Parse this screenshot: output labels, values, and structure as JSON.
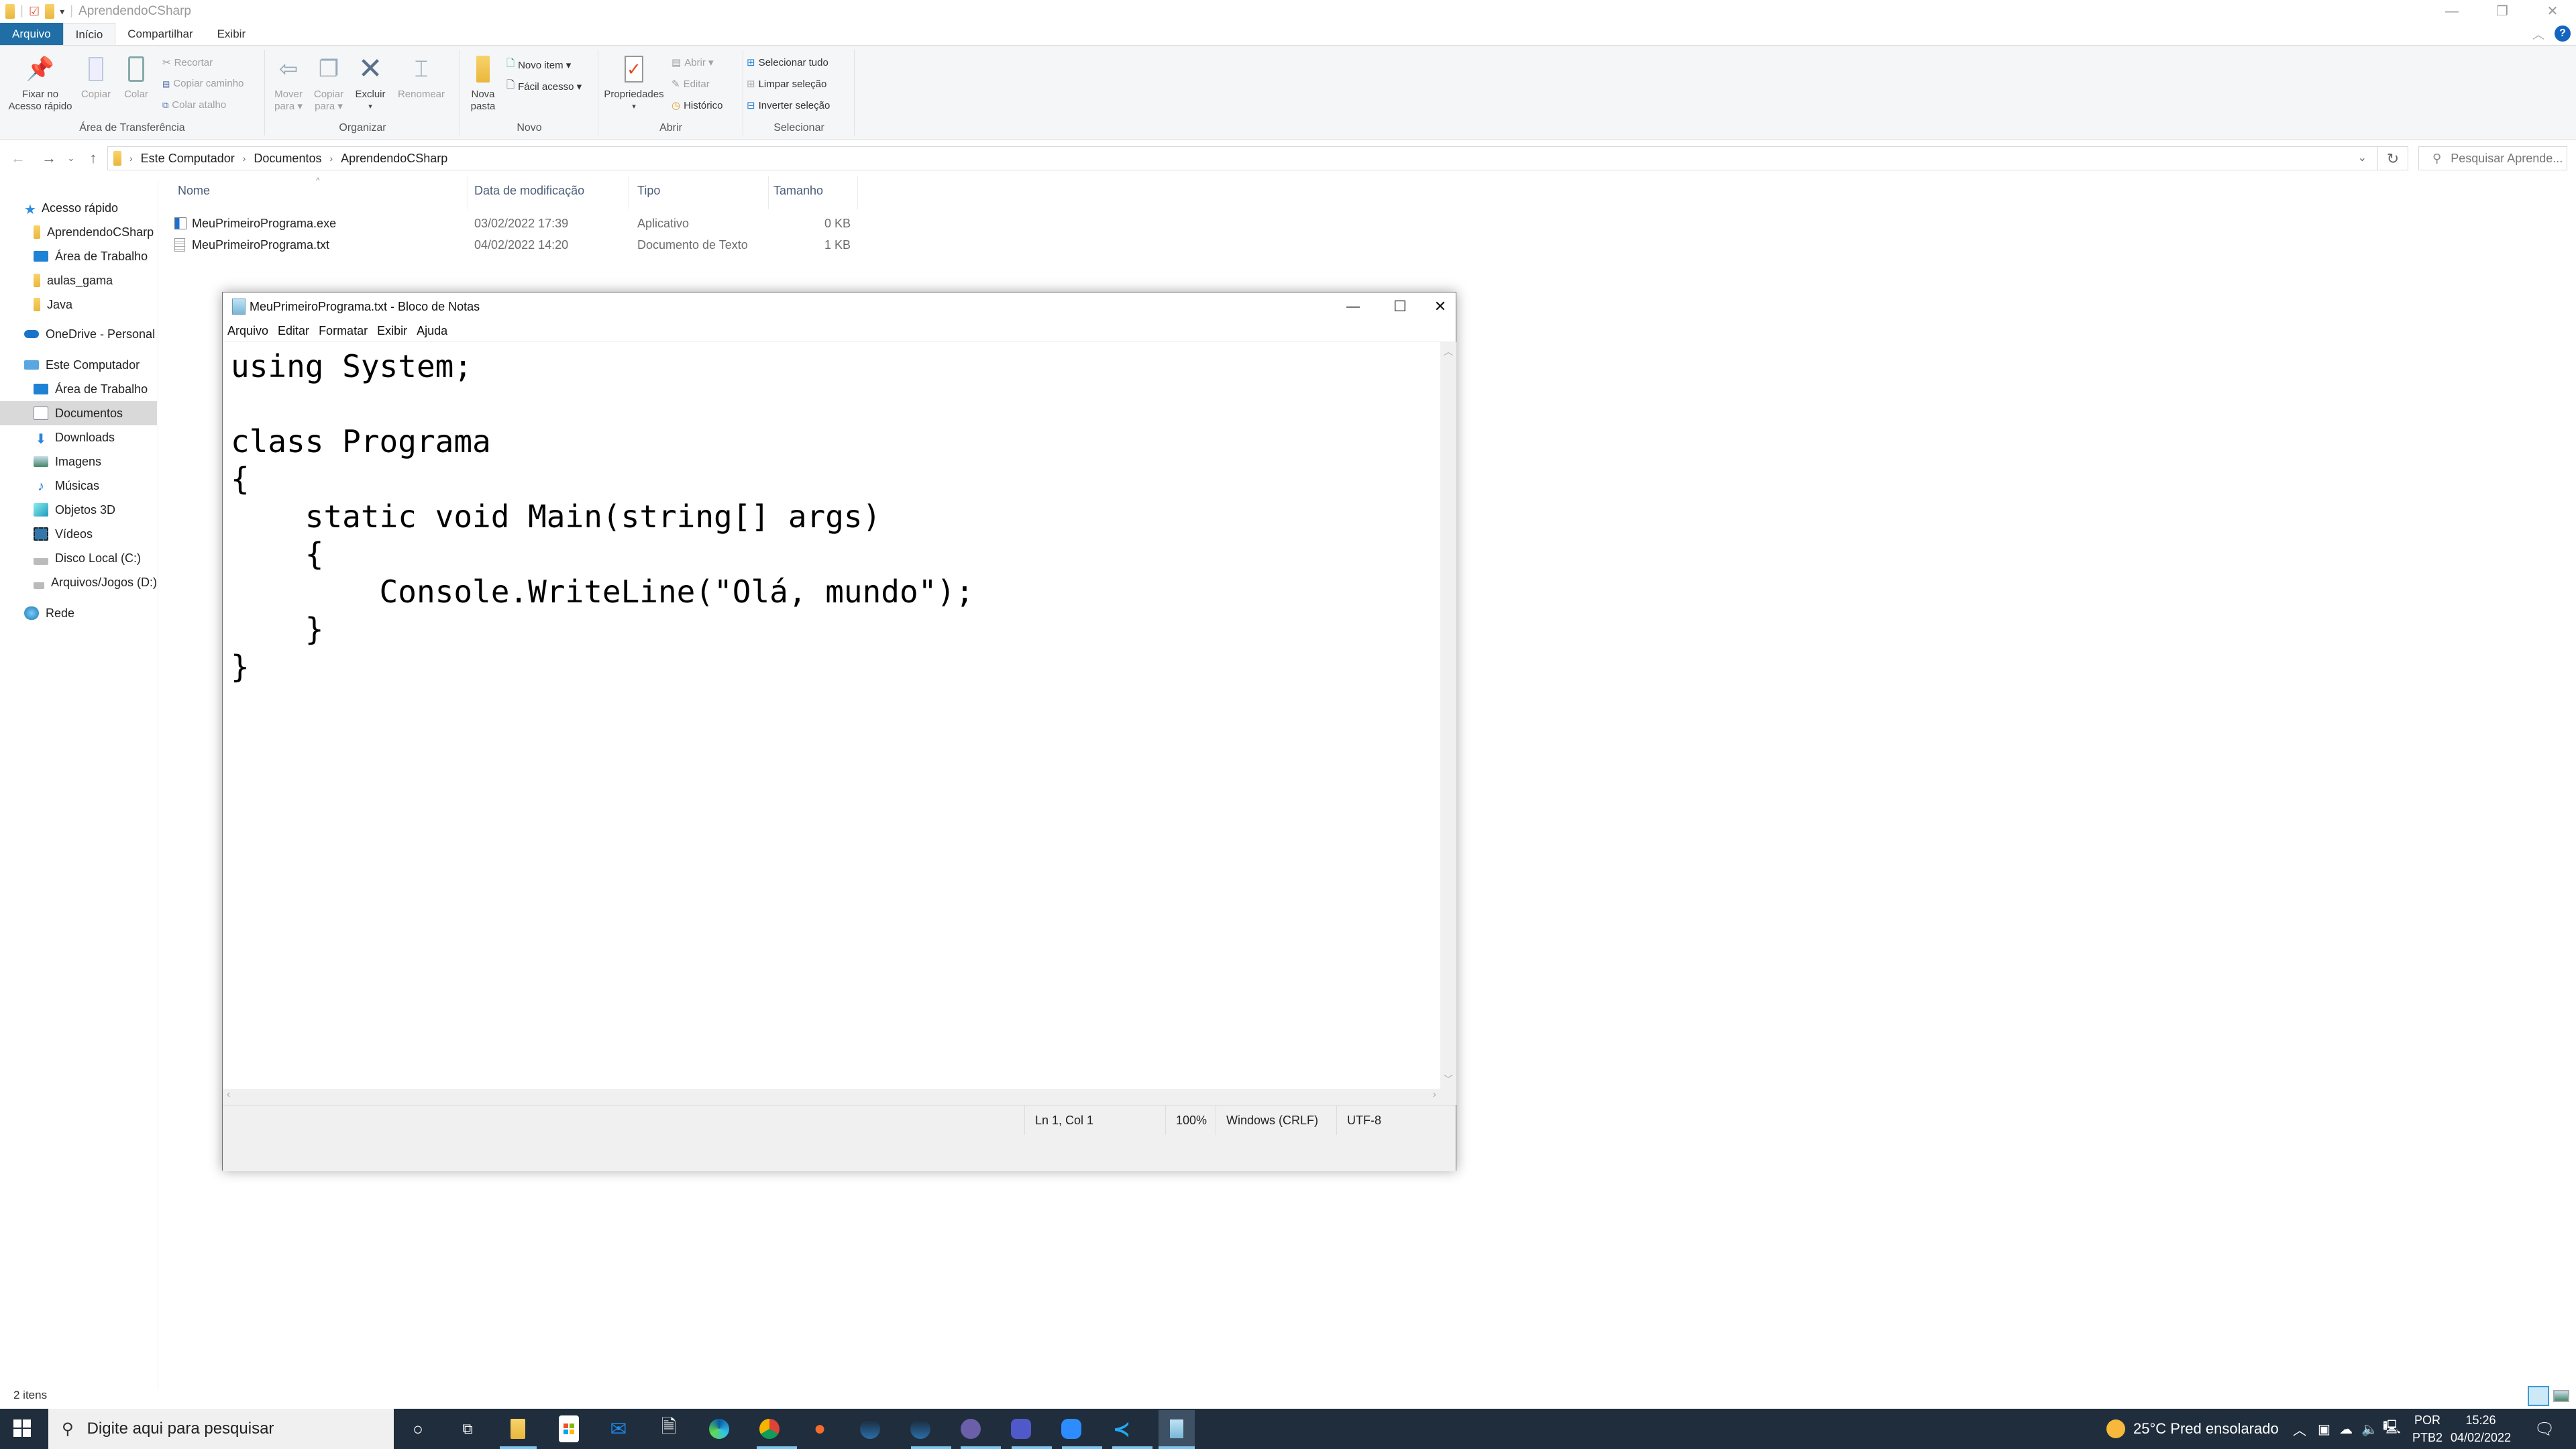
{
  "explorer": {
    "window_title": "AprendendoCSharp",
    "ribbon_tabs": [
      "Arquivo",
      "Início",
      "Compartilhar",
      "Exibir"
    ],
    "ribbon": {
      "clipboard": {
        "label": "Área de Transferência",
        "pin_line1": "Fixar no",
        "pin_line2": "Acesso rápido",
        "copy": "Copiar",
        "paste": "Colar",
        "cut": "Recortar",
        "copy_path": "Copiar caminho",
        "paste_shortcut": "Colar atalho"
      },
      "organize": {
        "label": "Organizar",
        "move_line1": "Mover",
        "move_line2": "para ▾",
        "copy_line1": "Copiar",
        "copy_line2": "para ▾",
        "delete": "Excluir",
        "delete_arrow": "▾",
        "rename": "Renomear"
      },
      "new": {
        "label": "Novo",
        "new_folder_line1": "Nova",
        "new_folder_line2": "pasta",
        "new_item": "Novo item ▾",
        "easy_access": "Fácil acesso ▾"
      },
      "open": {
        "label": "Abrir",
        "properties": "Propriedades",
        "properties_arrow": "▾",
        "open": "Abrir ▾",
        "edit": "Editar",
        "history": "Histórico"
      },
      "select": {
        "label": "Selecionar",
        "select_all": "Selecionar tudo",
        "select_none": "Limpar seleção",
        "invert": "Inverter seleção"
      }
    },
    "breadcrumb": [
      "Este Computador",
      "Documentos",
      "AprendendoCSharp"
    ],
    "search_placeholder": "Pesquisar Aprende...",
    "nav": {
      "quick_access": "Acesso rápido",
      "quick_items": [
        "AprendendoCSharp",
        "Área de Trabalho",
        "aulas_gama",
        "Java"
      ],
      "onedrive": "OneDrive - Personal",
      "this_pc": "Este Computador",
      "pc_items": [
        "Área de Trabalho",
        "Documentos",
        "Downloads",
        "Imagens",
        "Músicas",
        "Objetos 3D",
        "Vídeos",
        "Disco Local (C:)",
        "Arquivos/Jogos (D:)"
      ],
      "selected": "Documentos",
      "network": "Rede"
    },
    "columns": [
      "Nome",
      "Data de modificação",
      "Tipo",
      "Tamanho"
    ],
    "files": [
      {
        "name": "MeuPrimeiroPrograma.exe",
        "date": "03/02/2022 17:39",
        "type": "Aplicativo",
        "size": "0 KB",
        "icon": "exe-icon"
      },
      {
        "name": "MeuPrimeiroPrograma.txt",
        "date": "04/02/2022 14:20",
        "type": "Documento de Texto",
        "size": "1 KB",
        "icon": "txt-icon"
      }
    ],
    "status_count": "2 itens"
  },
  "notepad": {
    "title": "MeuPrimeiroPrograma.txt - Bloco de Notas",
    "menu": [
      "Arquivo",
      "Editar",
      "Formatar",
      "Exibir",
      "Ajuda"
    ],
    "content": "using System;\n\nclass Programa\n{\n    static void Main(string[] args)\n    {\n        Console.WriteLine(\"Olá, mundo\");\n    }\n}",
    "status": {
      "position": "Ln 1, Col 1",
      "zoom": "100%",
      "line_ending": "Windows (CRLF)",
      "encoding": "UTF-8"
    }
  },
  "taskbar": {
    "search_placeholder": "Digite aqui para pesquisar",
    "apps": [
      "cortana",
      "task-view",
      "file-explorer",
      "microsoft-store",
      "mail",
      "python-file",
      "edge",
      "chrome",
      "origin",
      "steam",
      "steam-2",
      "eclipse",
      "teams",
      "zoom",
      "vscode",
      "notepad"
    ],
    "weather": "25°C  Pred ensolarado",
    "lang_line1": "POR",
    "lang_line2": "PTB2",
    "time": "15:26",
    "date": "04/02/2022"
  },
  "colors": {
    "file_tab": "#1f6ea6",
    "taskbar": "#1f2d3d",
    "selection": "#d9d9d9",
    "accent_underline": "#7ec5f2"
  }
}
